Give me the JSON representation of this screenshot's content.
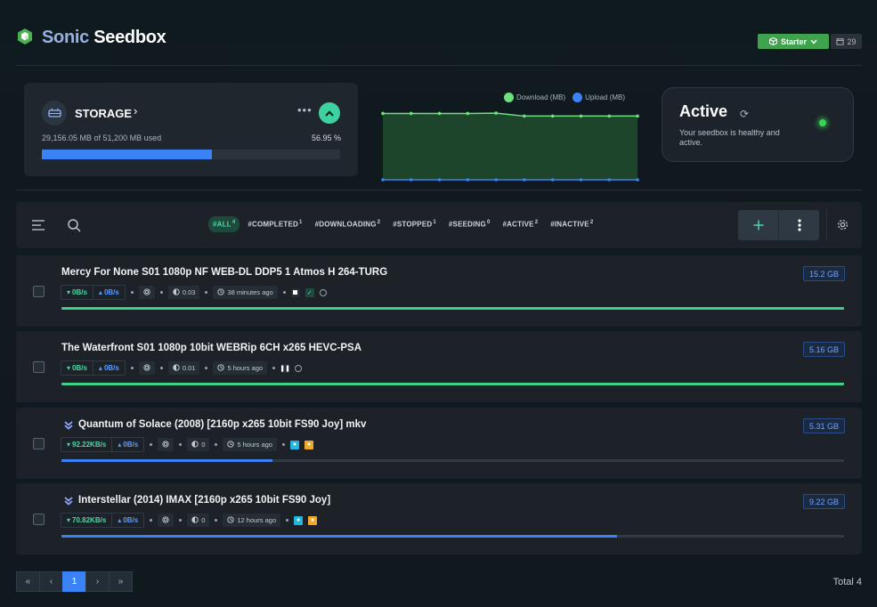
{
  "brand": {
    "part1": "Sonic",
    "part2": "Seedbox"
  },
  "header": {
    "plan_label": "Starter",
    "days_count": "29"
  },
  "storage": {
    "title": "STORAGE",
    "used_text": "29,156.05 MB of 51,200 MB used",
    "percent_text": "56.95 %",
    "percent": 0.5695
  },
  "chart_data": {
    "type": "line",
    "x": [
      1,
      2,
      3,
      4,
      5,
      6,
      7,
      8,
      9,
      10
    ],
    "series": [
      {
        "name": "Download (MB)",
        "color": "#6ee07f",
        "values": [
          100,
          100,
          100,
          100,
          100.5,
          96,
          96,
          96,
          96,
          96
        ]
      },
      {
        "name": "Upload (MB)",
        "color": "#3b82f6",
        "values": [
          0,
          0,
          0,
          0,
          0,
          0,
          0,
          0,
          0,
          0
        ]
      }
    ],
    "ylim": [
      0,
      110
    ],
    "grid": false,
    "legend": "top-center"
  },
  "legend": {
    "download": "Download (MB)",
    "upload": "Upload (MB)"
  },
  "status": {
    "title": "Active",
    "description": "Your seedbox is healthy and active."
  },
  "filters": [
    {
      "label": "#ALL",
      "count": "4",
      "active": true
    },
    {
      "label": "#COMPLETED",
      "count": "1",
      "active": false
    },
    {
      "label": "#DOWNLOADING",
      "count": "2",
      "active": false
    },
    {
      "label": "#STOPPED",
      "count": "1",
      "active": false
    },
    {
      "label": "#SEEDING",
      "count": "0",
      "active": false
    },
    {
      "label": "#ACTIVE",
      "count": "2",
      "active": false
    },
    {
      "label": "#INACTIVE",
      "count": "2",
      "active": false
    }
  ],
  "torrents": [
    {
      "name": "Mercy For None S01 1080p NF WEB-DL DDP5 1 Atmos H 264-TURG",
      "size": "15.2 GB",
      "down": "0B/s",
      "up": "0B/s",
      "ratio": "0.03",
      "time": "38 minutes ago",
      "progress": 1.0,
      "downloading": false
    },
    {
      "name": "The Waterfront S01 1080p 10bit WEBRip 6CH x265 HEVC-PSA",
      "size": "5.16 GB",
      "down": "0B/s",
      "up": "0B/s",
      "ratio": "0.01",
      "time": "5 hours ago",
      "progress": 1.0,
      "downloading": false
    },
    {
      "name": "Quantum of Solace (2008) [2160p x265 10bit FS90 Joy] mkv",
      "size": "5.31 GB",
      "down": "92.22KB/s",
      "up": "0B/s",
      "ratio": "0",
      "time": "5 hours ago",
      "progress": 0.27,
      "downloading": true
    },
    {
      "name": "Interstellar (2014) IMAX [2160p x265 10bit FS90 Joy]",
      "size": "9.22 GB",
      "down": "70.82KB/s",
      "up": "0B/s",
      "ratio": "0",
      "time": "12 hours ago",
      "progress": 0.71,
      "downloading": true
    }
  ],
  "pagination": {
    "first": "«",
    "prev": "‹",
    "current": "1",
    "next": "›",
    "last": "»"
  },
  "total_text": "Total 4",
  "colors": {
    "accent_green": "#4fd6a4",
    "accent_blue": "#3b82f6",
    "plan_green": "#3fa34d"
  }
}
